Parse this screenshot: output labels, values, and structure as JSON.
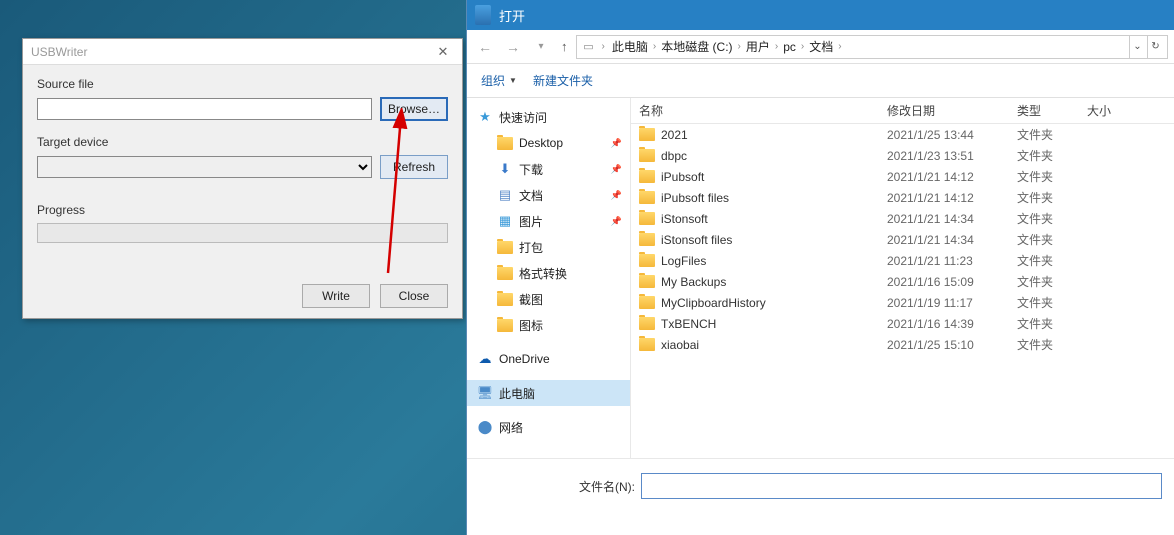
{
  "usbwriter": {
    "title": "USBWriter",
    "source_label": "Source file",
    "browse": "Browse…",
    "target_label": "Target device",
    "refresh": "Refresh",
    "progress_label": "Progress",
    "write": "Write",
    "close": "Close"
  },
  "filedialog": {
    "title": "打开",
    "breadcrumb": [
      "此电脑",
      "本地磁盘 (C:)",
      "用户",
      "pc",
      "文档"
    ],
    "toolbar": {
      "organize": "组织",
      "new_folder": "新建文件夹"
    },
    "sidebar": {
      "quick_access": "快速访问",
      "quick_items": [
        {
          "label": "Desktop",
          "icon": "folder",
          "pinned": true
        },
        {
          "label": "下载",
          "icon": "download",
          "pinned": true
        },
        {
          "label": "文档",
          "icon": "doc",
          "pinned": true
        },
        {
          "label": "图片",
          "icon": "pic",
          "pinned": true
        },
        {
          "label": "打包",
          "icon": "folder",
          "pinned": false
        },
        {
          "label": "格式转换",
          "icon": "folder",
          "pinned": false
        },
        {
          "label": "截图",
          "icon": "folder",
          "pinned": false
        },
        {
          "label": "图标",
          "icon": "folder",
          "pinned": false
        }
      ],
      "onedrive": "OneDrive",
      "this_pc": "此电脑",
      "network": "网络"
    },
    "columns": {
      "name": "名称",
      "date": "修改日期",
      "type": "类型",
      "size": "大小"
    },
    "files": [
      {
        "name": "2021",
        "date": "2021/1/25 13:44",
        "type": "文件夹"
      },
      {
        "name": "dbpc",
        "date": "2021/1/23 13:51",
        "type": "文件夹"
      },
      {
        "name": "iPubsoft",
        "date": "2021/1/21 14:12",
        "type": "文件夹"
      },
      {
        "name": "iPubsoft files",
        "date": "2021/1/21 14:12",
        "type": "文件夹"
      },
      {
        "name": "iStonsoft",
        "date": "2021/1/21 14:34",
        "type": "文件夹"
      },
      {
        "name": "iStonsoft files",
        "date": "2021/1/21 14:34",
        "type": "文件夹"
      },
      {
        "name": "LogFiles",
        "date": "2021/1/21 11:23",
        "type": "文件夹"
      },
      {
        "name": "My Backups",
        "date": "2021/1/16 15:09",
        "type": "文件夹"
      },
      {
        "name": "MyClipboardHistory",
        "date": "2021/1/19 11:17",
        "type": "文件夹"
      },
      {
        "name": "TxBENCH",
        "date": "2021/1/16 14:39",
        "type": "文件夹"
      },
      {
        "name": "xiaobai",
        "date": "2021/1/25 15:10",
        "type": "文件夹"
      }
    ],
    "filename_label": "文件名(N):"
  }
}
